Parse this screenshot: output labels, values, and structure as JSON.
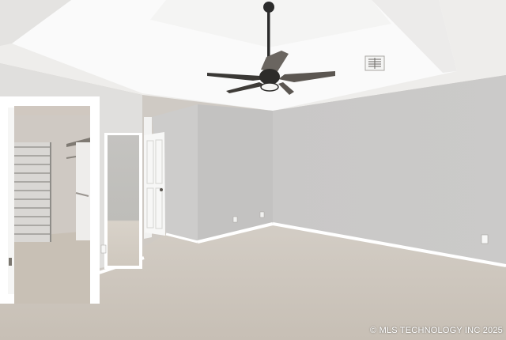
{
  "watermark": "© MLS TECHNOLOGY INC 2025",
  "colors": {
    "ceiling": "#f2f1ef",
    "tray_ceiling": "#fbfbfa",
    "wall_right": "#c8c7c6",
    "wall_center": "#c3c2c1",
    "wall_left": "#dcdbd9",
    "carpet": "#cdc6bd",
    "trim": "#ffffff",
    "fan": "#2b2b2b"
  },
  "icons": [
    "ceiling-fan-icon",
    "air-vent-icon",
    "electrical-outlet-icon"
  ]
}
